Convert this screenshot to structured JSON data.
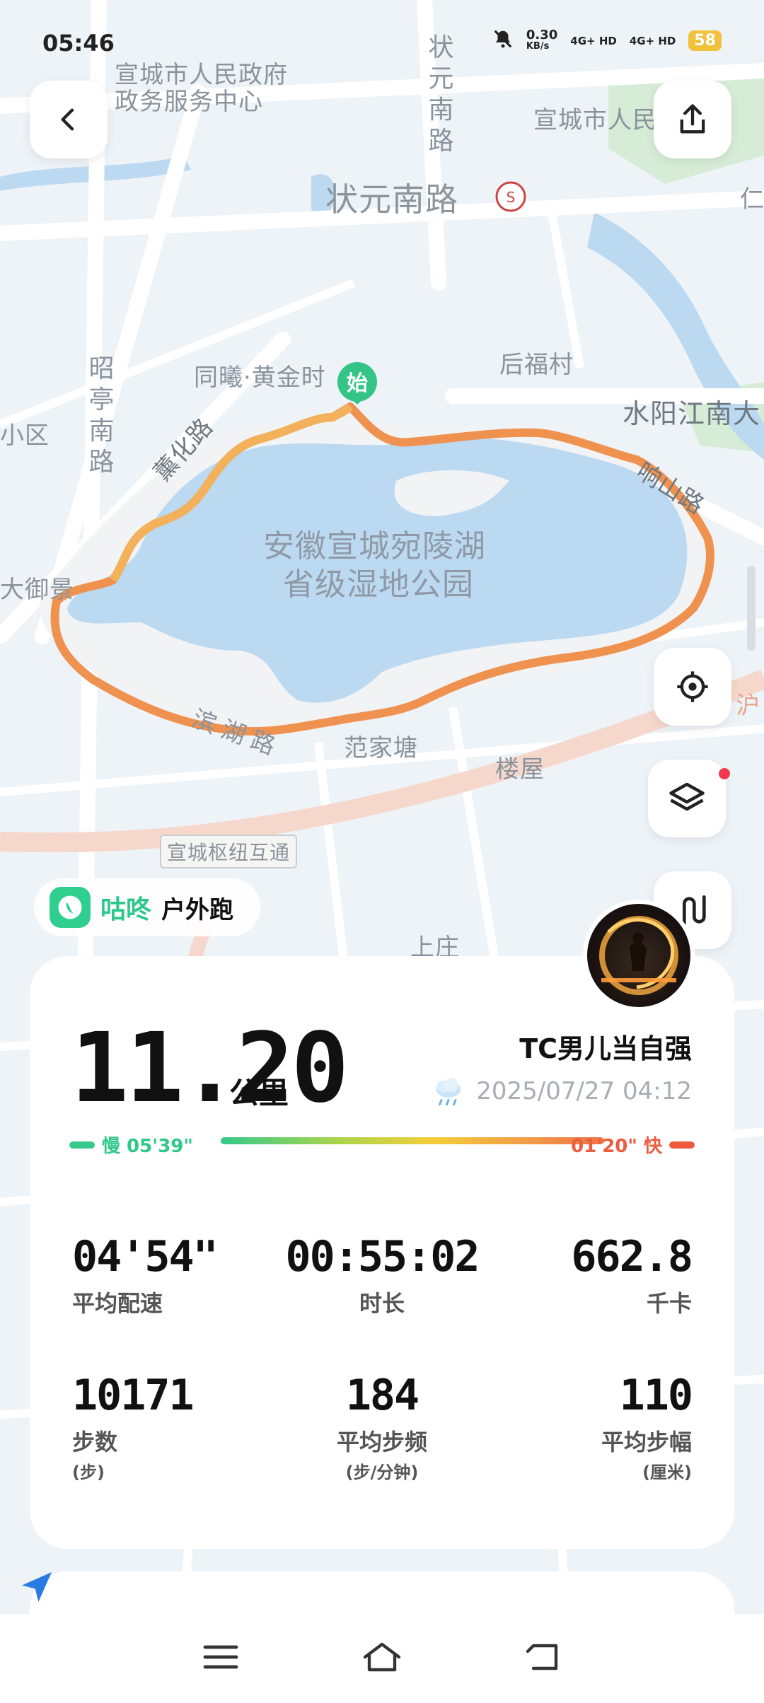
{
  "status": {
    "time": "05:46",
    "net_speed_value": "0.30",
    "net_speed_unit": "KB/s",
    "sim1": "4G+ HD",
    "sim2": "4G+ HD",
    "battery": "58"
  },
  "map": {
    "labels": {
      "gov_center_1": "宣城市人民政府",
      "gov_center_2": "政务服务中心",
      "zhuangyuan_south_vertical": "状元南路",
      "people_top_right": "宣城市人民",
      "zhuangyuan_south": "状元南路",
      "ren": "仁",
      "tongxi": "同曦·黄金时",
      "houfucun": "后福村",
      "shuiyang": "水阳江南大",
      "xiaoqu": "小区",
      "zhaoting": "昭亭南路",
      "xunhua": "薰化路",
      "xiangshan": "响山路",
      "lake_1": "安徽宣城宛陵湖",
      "lake_2": "省级湿地公园",
      "dayujing": "大御景",
      "binhu": "滨湖路",
      "fanjiatang": "范家塘",
      "louwu": "楼屋",
      "interchange": "宣城枢纽互通",
      "shangzhuang": "上庄",
      "hu": "沪"
    },
    "start_marker": "始",
    "route_color": "#ee8a4a"
  },
  "brand": {
    "name": "咕咚",
    "activity": "户外跑"
  },
  "summary": {
    "distance": "11.20",
    "distance_unit": "公里",
    "username": "TC男儿当自强",
    "datetime": "2025/07/27 04:12",
    "weather_icon": "cloud-rain-icon",
    "pace_slow_label": "慢 05'39\"",
    "pace_fast_label": "01'20\" 快"
  },
  "stats": {
    "avg_pace": {
      "value": "04'54\"",
      "label": "平均配速"
    },
    "duration": {
      "value": "00:55:02",
      "label": "时长"
    },
    "calories": {
      "value": "662.8",
      "label": "千卡"
    },
    "steps": {
      "value": "10171",
      "label": "步数",
      "unit": "(步)"
    },
    "cadence": {
      "value": "184",
      "label": "平均步频",
      "unit": "(步/分钟)"
    },
    "stride": {
      "value": "110",
      "label": "平均步幅",
      "unit": "(厘米)"
    }
  }
}
